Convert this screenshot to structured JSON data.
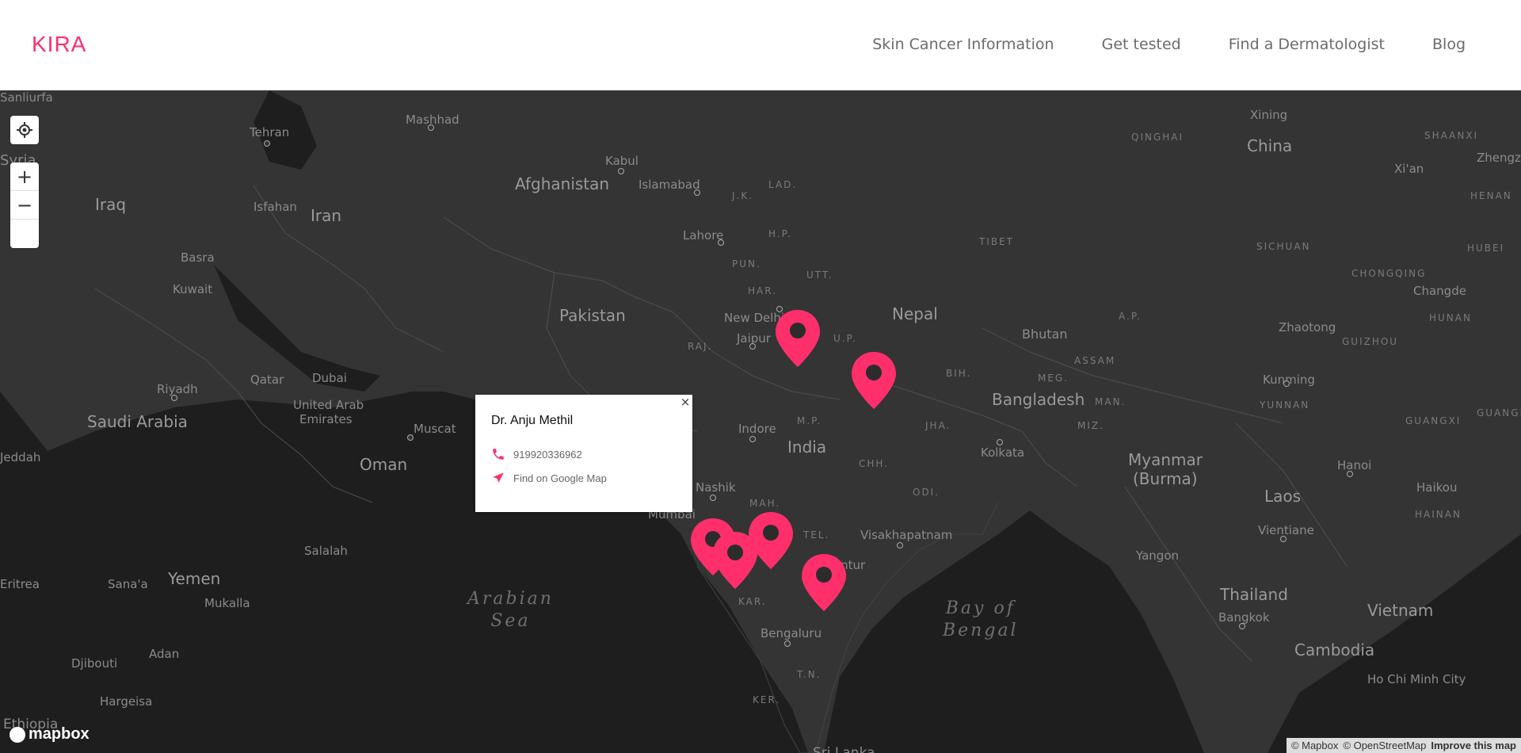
{
  "header": {
    "logo": "KIRA",
    "nav": [
      "Skin Cancer Information",
      "Get tested",
      "Find a Dermatologist",
      "Blog"
    ]
  },
  "map": {
    "controls": {
      "zoom_in": "+",
      "zoom_out": "−"
    },
    "labels": {
      "countries": [
        "Afghanistan",
        "Pakistan",
        "Iran",
        "Iraq",
        "Saudi Arabia",
        "Oman",
        "Yemen",
        "India",
        "Nepal",
        "Bhutan",
        "Bangladesh",
        "China",
        "Myanmar",
        "(Burma)",
        "Laos",
        "Thailand",
        "Vietnam",
        "Cambodia"
      ],
      "cities": [
        "Tehran",
        "Mashhad",
        "Kabul",
        "Islamabad",
        "Lahore",
        "Isfahan",
        "Basra",
        "Kuwait",
        "Riyadh",
        "Qatar",
        "Dubai",
        "United Arab",
        "Emirates",
        "Muscat",
        "Salalah",
        "Sana'a",
        "Mukalla",
        "Adan",
        "Djibouti",
        "Hargeisa",
        "Ethiopia",
        "Eritrea",
        "Jeddah",
        "Sanliurfa",
        "Syria",
        "New Delhi",
        "Jaipur",
        "Indore",
        "Nashik",
        "Mumbai",
        "Visakhapatnam",
        "Guntur",
        "Bengaluru",
        "Kolkata",
        "Xining",
        "Xi'an",
        "Zhengzh",
        "Changde",
        "Zhaotong",
        "Kunming",
        "Yangon",
        "Vientiane",
        "Hanoi",
        "Haikou",
        "Bangkok",
        "Ho Chi Minh City",
        "Sri Lanka"
      ],
      "regions": [
        "QINGHAI",
        "SHAANXI",
        "HENAN",
        "HUBEI",
        "HUNAN",
        "SICHUAN",
        "CHONGQING",
        "GUIZHOU",
        "YUNNAN",
        "GUANGXI",
        "GUANGD",
        "HAINAN",
        "TIBET",
        "ASSAM",
        "MEG.",
        "MAN.",
        "MIZ.",
        "BIH.",
        "JHA.",
        "U.P.",
        "UTT.",
        "H.P.",
        "PUN.",
        "HAR.",
        "RAJ.",
        "M.P.",
        "CHH.",
        "ODI.",
        "MAH.",
        "TEL.",
        "KAR.",
        "T.N.",
        "KER.",
        "J.K.",
        "LAD.",
        "A.P."
      ],
      "seas": [
        "Arabian\nSea",
        "Bay of\nBengal"
      ]
    },
    "popup": {
      "name": "Dr. Anju Methil",
      "phone": "919920336962",
      "link": "Find on Google Map",
      "close": "×"
    },
    "attribution": {
      "mapbox": "© Mapbox",
      "osm": "© OpenStreetMap",
      "improve": "Improve this map"
    },
    "logo": "mapbox",
    "accent": "#ff2f6b"
  }
}
